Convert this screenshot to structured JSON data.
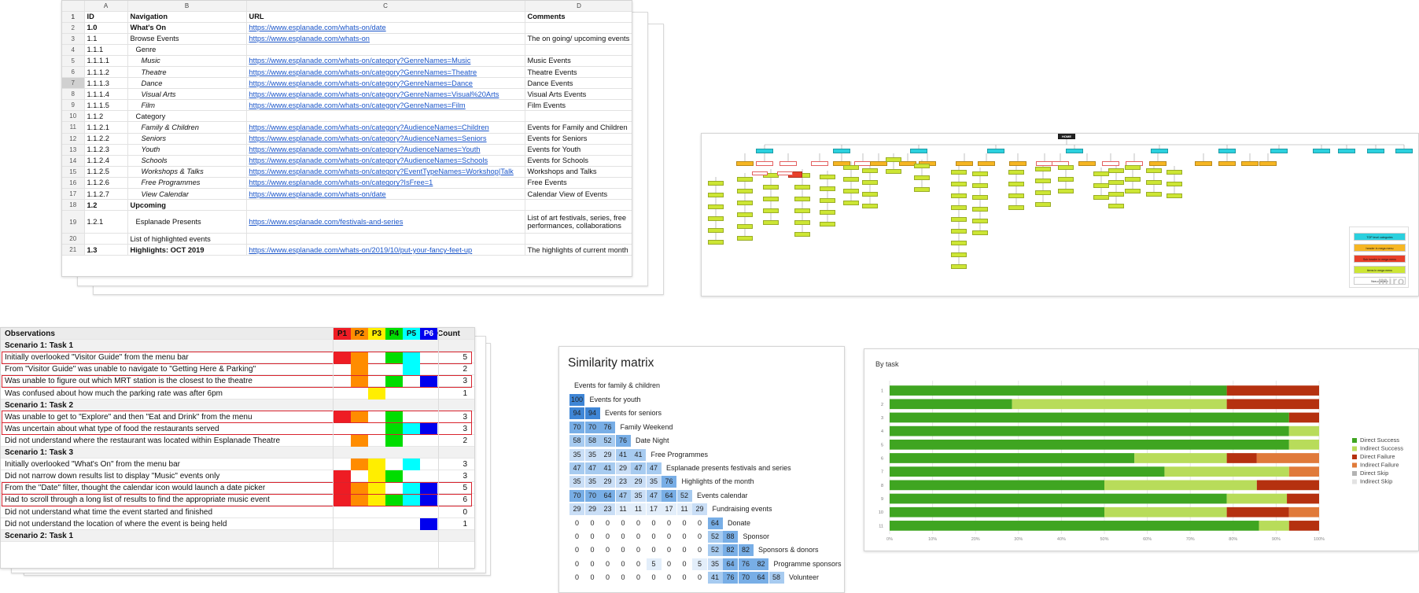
{
  "sitemap_sheet": {
    "col_letters": [
      "A",
      "B",
      "C",
      "D"
    ],
    "headers": [
      "ID",
      "Navigation",
      "URL",
      "Comments"
    ],
    "rows": [
      {
        "n": "2",
        "id": "1.0",
        "nav": "What's On",
        "url": "https://www.esplanade.com/whats-on/date",
        "comment": "",
        "bold": true,
        "indent": 0,
        "italic": false
      },
      {
        "n": "3",
        "id": "1.1",
        "nav": "Browse Events",
        "url": "https://www.esplanade.com/whats-on",
        "comment": "The on going/ upcoming events",
        "bold": false,
        "indent": 0,
        "italic": false
      },
      {
        "n": "4",
        "id": "1.1.1",
        "nav": "Genre",
        "url": "",
        "comment": "",
        "bold": false,
        "indent": 1,
        "italic": false
      },
      {
        "n": "5",
        "id": "1.1.1.1",
        "nav": "Music",
        "url": "https://www.esplanade.com/whats-on/category?GenreNames=Music",
        "comment": "Music Events",
        "bold": false,
        "indent": 2,
        "italic": true
      },
      {
        "n": "6",
        "id": "1.1.1.2",
        "nav": "Theatre",
        "url": "https://www.esplanade.com/whats-on/category?GenreNames=Theatre",
        "comment": "Theatre Events",
        "bold": false,
        "indent": 2,
        "italic": true
      },
      {
        "n": "7",
        "id": "1.1.1.3",
        "nav": "Dance",
        "url": "https://www.esplanade.com/whats-on/category?GenreNames=Dance",
        "comment": "Dance Events",
        "bold": false,
        "indent": 2,
        "italic": true
      },
      {
        "n": "8",
        "id": "1.1.1.4",
        "nav": "Visual Arts",
        "url": "https://www.esplanade.com/whats-on/category?GenreNames=Visual%20Arts",
        "comment": "Visual Arts Events",
        "bold": false,
        "indent": 2,
        "italic": true
      },
      {
        "n": "9",
        "id": "1.1.1.5",
        "nav": "Film",
        "url": "https://www.esplanade.com/whats-on/category?GenreNames=Film",
        "comment": "Film Events",
        "bold": false,
        "indent": 2,
        "italic": true
      },
      {
        "n": "10",
        "id": "1.1.2",
        "nav": "Category",
        "url": "",
        "comment": "",
        "bold": false,
        "indent": 1,
        "italic": false
      },
      {
        "n": "11",
        "id": "1.1.2.1",
        "nav": "Family & Children",
        "url": "https://www.esplanade.com/whats-on/category?AudienceNames=Children",
        "comment": "Events for Family and Children",
        "bold": false,
        "indent": 2,
        "italic": true
      },
      {
        "n": "12",
        "id": "1.1.2.2",
        "nav": "Seniors",
        "url": "https://www.esplanade.com/whats-on/category?AudienceNames=Seniors",
        "comment": "Events for Seniors",
        "bold": false,
        "indent": 2,
        "italic": true
      },
      {
        "n": "13",
        "id": "1.1.2.3",
        "nav": "Youth",
        "url": "https://www.esplanade.com/whats-on/category?AudienceNames=Youth",
        "comment": "Events for Youth",
        "bold": false,
        "indent": 2,
        "italic": true
      },
      {
        "n": "14",
        "id": "1.1.2.4",
        "nav": "Schools",
        "url": "https://www.esplanade.com/whats-on/category?AudienceNames=Schools",
        "comment": "Events for Schools",
        "bold": false,
        "indent": 2,
        "italic": true
      },
      {
        "n": "15",
        "id": "1.1.2.5",
        "nav": "Workshops & Talks",
        "url": "https://www.esplanade.com/whats-on/category?EventTypeNames=Workshop|Talk",
        "comment": "Workshops and Talks",
        "bold": false,
        "indent": 2,
        "italic": true
      },
      {
        "n": "16",
        "id": "1.1.2.6",
        "nav": "Free Programmes",
        "url": "https://www.esplanade.com/whats-on/category?IsFree=1",
        "comment": "Free Events",
        "bold": false,
        "indent": 2,
        "italic": true
      },
      {
        "n": "17",
        "id": "1.1.2.7",
        "nav": "View Calendar",
        "url": "https://www.esplanade.com/whats-on/date",
        "comment": "Calendar View of Events",
        "bold": false,
        "indent": 2,
        "italic": true
      },
      {
        "n": "18",
        "id": "1.2",
        "nav": "Upcoming",
        "url": "",
        "comment": "",
        "bold": true,
        "indent": 0,
        "italic": false
      },
      {
        "n": "19",
        "id": "1.2.1",
        "nav": "Esplanade Presents",
        "url": "https://www.esplanade.com/festivals-and-series",
        "comment": "List of art festivals, series, free performances, collaborations",
        "bold": false,
        "indent": 1,
        "italic": false,
        "tall": true
      },
      {
        "n": "20",
        "id": "",
        "nav": "List of highlighted events",
        "url": "",
        "comment": "",
        "bold": false,
        "indent": 0,
        "italic": false
      },
      {
        "n": "21",
        "id": "1.3",
        "nav": "Highlights: OCT 2019",
        "url": "https://www.esplanade.com/whats-on/2019/10/put-your-fancy-feet-up",
        "comment": "The highlights of current month",
        "bold": true,
        "indent": 0,
        "italic": false
      }
    ]
  },
  "sitemap_diagram": {
    "home_label": "HOME",
    "legend": [
      {
        "label": "TOP level categories",
        "color": "#2bd0de"
      },
      {
        "label": "header in mega menu",
        "color": "#f6b623"
      },
      {
        "label": "Sub header in mega menu",
        "color": "#e8402a"
      },
      {
        "label": "items in mega menu",
        "color": "#cde635"
      },
      {
        "label": "Non-clickable",
        "color": "#ffffff"
      }
    ],
    "watermark": "miro"
  },
  "observations": {
    "header": {
      "label": "Observations",
      "count": "Count"
    },
    "personas": [
      {
        "label": "P1",
        "color": "#ee1c24"
      },
      {
        "label": "P2",
        "color": "#ff8c00"
      },
      {
        "label": "P3",
        "color": "#ffee00"
      },
      {
        "label": "P4",
        "color": "#00dd00"
      },
      {
        "label": "P5",
        "color": "#00ffff"
      },
      {
        "label": "P6",
        "color": "#0000ee"
      }
    ],
    "rows": [
      {
        "text": "Scenario 1: Task 1",
        "count": "",
        "section": true,
        "marks": [],
        "box": false
      },
      {
        "text": "Initially overlooked \"Visitor Guide\" from the menu bar",
        "count": "5",
        "section": false,
        "marks": [
          1,
          1,
          0,
          1,
          1,
          0
        ],
        "box": true
      },
      {
        "text": "From \"Visitor Guide\" was unable to navigate to \"Getting Here & Parking\"",
        "count": "2",
        "section": false,
        "marks": [
          0,
          1,
          0,
          0,
          1,
          0
        ],
        "box": false
      },
      {
        "text": "Was unable to figure out which MRT station is the closest to the theatre",
        "count": "3",
        "section": false,
        "marks": [
          0,
          1,
          0,
          1,
          0,
          1
        ],
        "box": true
      },
      {
        "text": "Was confused about how much the parking rate was after 6pm",
        "count": "1",
        "section": false,
        "marks": [
          0,
          0,
          1,
          0,
          0,
          0
        ],
        "box": false
      },
      {
        "text": "Scenario 1: Task 2",
        "count": "",
        "section": true,
        "marks": [],
        "box": false
      },
      {
        "text": "Was unable to get to \"Explore\" and then \"Eat and Drink\" from the menu",
        "count": "3",
        "section": false,
        "marks": [
          1,
          1,
          0,
          1,
          0,
          0
        ],
        "box": true
      },
      {
        "text": "Was uncertain about what type of food the restaurants served",
        "count": "3",
        "section": false,
        "marks": [
          0,
          0,
          0,
          1,
          1,
          1
        ],
        "box": true
      },
      {
        "text": "Did not understand where the restaurant was located within Esplanade Theatre",
        "count": "2",
        "section": false,
        "marks": [
          0,
          1,
          0,
          1,
          0,
          0
        ],
        "box": false
      },
      {
        "text": "Scenario 1: Task 3",
        "count": "",
        "section": true,
        "marks": [],
        "box": false
      },
      {
        "text": "Initially overlooked \"What's On\" from the menu bar",
        "count": "3",
        "section": false,
        "marks": [
          0,
          1,
          1,
          0,
          1,
          0
        ],
        "box": false
      },
      {
        "text": "Did not narrow down results list to display \"Music\" events only",
        "count": "3",
        "section": false,
        "marks": [
          1,
          0,
          1,
          1,
          0,
          0
        ],
        "box": false
      },
      {
        "text": "From the \"Date\" filter, thought the calendar icon would launch a date picker",
        "count": "5",
        "section": false,
        "marks": [
          1,
          1,
          1,
          0,
          1,
          1
        ],
        "box": true
      },
      {
        "text": "Had to scroll through a long list of results to find the appropriate music event",
        "count": "6",
        "section": false,
        "marks": [
          1,
          1,
          1,
          1,
          1,
          1
        ],
        "box": true
      },
      {
        "text": "Did not understand what time the event started and finished",
        "count": "0",
        "section": false,
        "marks": [
          0,
          0,
          0,
          0,
          0,
          0
        ],
        "box": false
      },
      {
        "text": "Did not understand the location of where the event is being held",
        "count": "1",
        "section": false,
        "marks": [
          0,
          0,
          0,
          0,
          0,
          1
        ],
        "box": false
      },
      {
        "text": "Scenario 2: Task 1",
        "count": "",
        "section": true,
        "marks": [],
        "box": false
      }
    ]
  },
  "similarity_matrix": {
    "title": "Similarity matrix",
    "labels": [
      "Events for family & children",
      "Events for youth",
      "Events for seniors",
      "Family Weekend",
      "Date Night",
      "Free Programmes",
      "Esplanade presents festivals and series",
      "Highlights of the month",
      "Events calendar",
      "Fundraising events",
      "Donate",
      "Sponsor",
      "Sponsors & donors",
      "Programme sponsors",
      "Volunteer"
    ],
    "rows": [
      [
        100
      ],
      [
        94,
        94
      ],
      [
        70,
        70,
        76
      ],
      [
        58,
        58,
        52,
        76
      ],
      [
        35,
        35,
        29,
        41,
        41
      ],
      [
        47,
        47,
        41,
        29,
        47,
        47
      ],
      [
        35,
        35,
        29,
        23,
        29,
        35,
        76
      ],
      [
        70,
        70,
        64,
        47,
        35,
        47,
        64,
        52
      ],
      [
        29,
        29,
        23,
        11,
        11,
        17,
        17,
        11,
        29
      ],
      [
        0,
        0,
        0,
        0,
        0,
        0,
        0,
        0,
        0,
        64
      ],
      [
        0,
        0,
        0,
        0,
        0,
        0,
        0,
        0,
        0,
        52,
        88
      ],
      [
        0,
        0,
        0,
        0,
        0,
        0,
        0,
        0,
        0,
        52,
        82,
        82
      ],
      [
        0,
        0,
        0,
        0,
        0,
        5,
        0,
        0,
        5,
        35,
        64,
        76,
        82
      ],
      [
        0,
        0,
        0,
        0,
        0,
        0,
        0,
        0,
        0,
        41,
        76,
        70,
        64,
        58
      ]
    ]
  },
  "by_task": {
    "title": "By task",
    "chart_data": {
      "type": "bar",
      "orientation": "horizontal",
      "stacked": true,
      "categories": [
        "1",
        "2",
        "3",
        "4",
        "5",
        "6",
        "7",
        "8",
        "9",
        "10",
        "11"
      ],
      "xlim": [
        0,
        100
      ],
      "xticks": [
        "0%",
        "10%",
        "20%",
        "30%",
        "40%",
        "50%",
        "60%",
        "70%",
        "80%",
        "90%",
        "100%"
      ],
      "series": [
        {
          "name": "Direct Success",
          "color": "#3fa521",
          "values": [
            78.5,
            28.5,
            93,
            93,
            93,
            57,
            64,
            50,
            78.5,
            50,
            86
          ]
        },
        {
          "name": "Indirect Success",
          "color": "#b8dc5a",
          "values": [
            0,
            50,
            0,
            7,
            7,
            21.5,
            29,
            35.5,
            14,
            28.5,
            7
          ]
        },
        {
          "name": "Direct Failure",
          "color": "#b5310f",
          "values": [
            21.5,
            21.5,
            7,
            0,
            0,
            7,
            0,
            14.5,
            7.5,
            14.5,
            7
          ]
        },
        {
          "name": "Indirect Failure",
          "color": "#e07a3a",
          "values": [
            0,
            0,
            0,
            0,
            0,
            14.5,
            7,
            0,
            0,
            7,
            0
          ]
        },
        {
          "name": "Direct Skip",
          "color": "#b3b3b3",
          "values": [
            0,
            0,
            0,
            0,
            0,
            0,
            0,
            0,
            0,
            0,
            0
          ]
        },
        {
          "name": "Indirect Skip",
          "color": "#e3e3e3",
          "values": [
            0,
            0,
            0,
            0,
            0,
            0,
            0,
            0,
            0,
            0,
            0
          ]
        }
      ],
      "legend_position": "right",
      "grid": true
    }
  }
}
